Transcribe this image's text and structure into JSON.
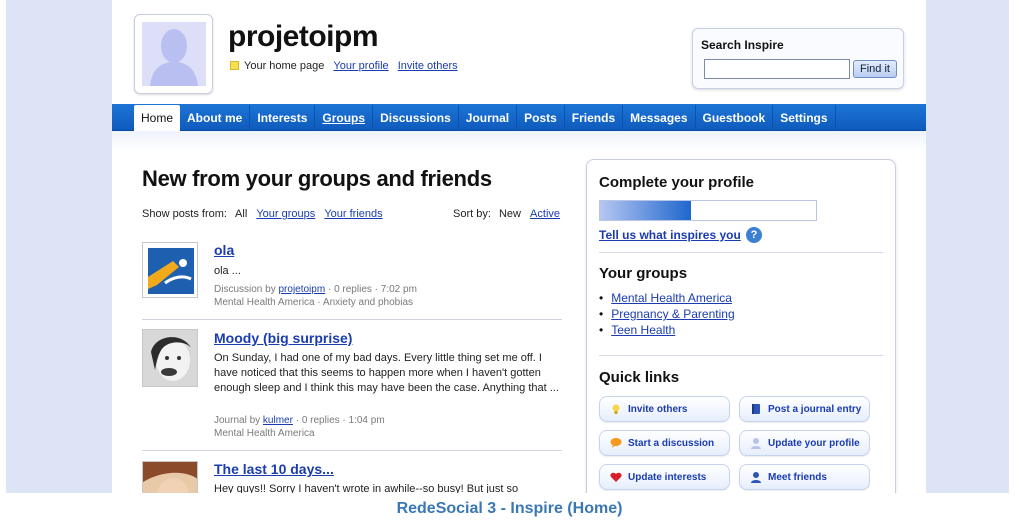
{
  "header": {
    "username": "projetoipm",
    "home_label": "Your home page",
    "profile_link": "Your profile",
    "invite_link": "Invite others"
  },
  "search": {
    "title": "Search Inspire",
    "input_value": "",
    "button_label": "Find it"
  },
  "nav": {
    "items": [
      "Home",
      "About me",
      "Interests",
      "Groups",
      "Discussions",
      "Journal",
      "Posts",
      "Friends",
      "Messages",
      "Guestbook",
      "Settings"
    ],
    "active": "Home"
  },
  "feed": {
    "title": "New from your groups and friends",
    "filter_label": "Show posts from:",
    "filter_all": "All",
    "filter_groups": "Your groups",
    "filter_friends": "Your friends",
    "sort_label": "Sort by:",
    "sort_new": "New",
    "sort_active": "Active",
    "posts": [
      {
        "title": "ola",
        "body": "ola ...",
        "meta_prefix": "Discussion by",
        "author": "projetoipm",
        "meta_suffix": "· 0 replies · 7:02 pm",
        "tags": "Mental Health America · Anxiety and phobias"
      },
      {
        "title": "Moody (big surprise)",
        "body": "On Sunday, I had one of my bad days. Every little thing set me off. I have noticed that this seems to happen more when I haven't gotten enough sleep and I think this may have been the case. Anything that ...",
        "meta_prefix": "Journal by",
        "author": "kulmer",
        "meta_suffix": "· 0 replies · 1:04 pm",
        "tags": "Mental Health America"
      },
      {
        "title": "The last 10 days...",
        "body": "Hey guys!! Sorry I haven't wrote in awhile--so busy! But just so"
      }
    ]
  },
  "sidebar": {
    "complete_title": "Complete your profile",
    "progress_fraction": 0.42,
    "tell_us": "Tell us what inspires you",
    "groups_title": "Your groups",
    "groups": [
      "Mental Health America",
      "Pregnancy & Parenting",
      "Teen Health"
    ],
    "quick_title": "Quick links",
    "quick_links": [
      "Invite others",
      "Post a journal entry",
      "Start a discussion",
      "Update your profile",
      "Update interests",
      "Meet friends"
    ]
  },
  "caption": "RedeSocial 3 - Inspire (Home)",
  "colors": {
    "nav_blue": "#1467cf",
    "link_blue": "#1a3cb0",
    "caption_blue": "#3a78b5"
  }
}
